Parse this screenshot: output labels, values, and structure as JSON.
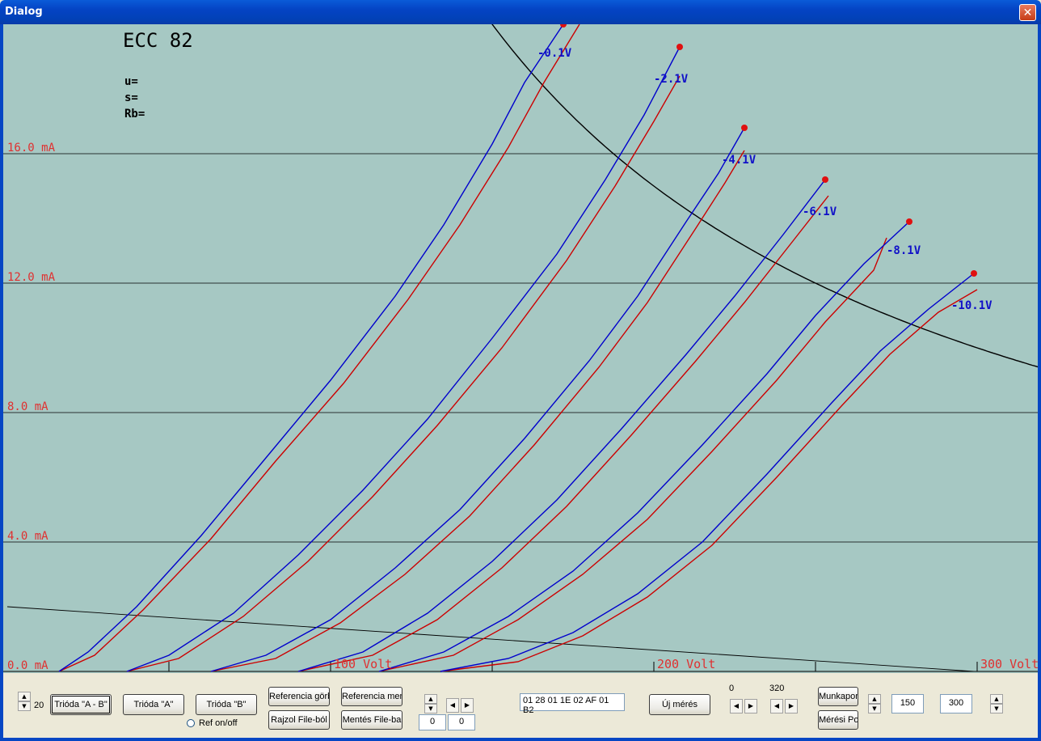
{
  "window": {
    "title": "Dialog",
    "close_label": "✕"
  },
  "chart_data": {
    "type": "line",
    "title": "ECC 82",
    "params": [
      "u=",
      "s=",
      "Rb="
    ],
    "xlim": [
      0,
      320
    ],
    "ylim": [
      0,
      20
    ],
    "x_tick_labels": [
      {
        "x": 100,
        "label": "100 Volt"
      },
      {
        "x": 200,
        "label": "200 Volt"
      },
      {
        "x": 300,
        "label": "300 Volt"
      }
    ],
    "y_tick_labels": [
      {
        "y": 0,
        "label": "0.0 mA"
      },
      {
        "y": 4,
        "label": "4.0 mA"
      },
      {
        "y": 8,
        "label": "8.0 mA"
      },
      {
        "y": 12,
        "label": "12.0 mA"
      },
      {
        "y": 16,
        "label": "16.0 mA"
      }
    ],
    "grid_y": [
      4,
      8,
      12,
      16
    ],
    "minor_x_ticks": [
      50,
      100,
      150,
      200,
      250,
      300
    ],
    "series_colors": {
      "A": "#0000cc",
      "B": "#cc0000"
    },
    "curves": [
      {
        "label": "-0.1V",
        "end": [
          172,
          20.0
        ],
        "A": [
          [
            16,
            0
          ],
          [
            25,
            0.6
          ],
          [
            40,
            2.0
          ],
          [
            60,
            4.2
          ],
          [
            80,
            6.6
          ],
          [
            100,
            9.0
          ],
          [
            120,
            11.6
          ],
          [
            135,
            13.8
          ],
          [
            150,
            16.3
          ],
          [
            160,
            18.2
          ],
          [
            172,
            20.0
          ]
        ],
        "B": [
          [
            16,
            0
          ],
          [
            27,
            0.5
          ],
          [
            42,
            1.9
          ],
          [
            63,
            4.1
          ],
          [
            83,
            6.5
          ],
          [
            104,
            8.9
          ],
          [
            124,
            11.5
          ],
          [
            140,
            13.8
          ],
          [
            155,
            16.2
          ],
          [
            166,
            18.2
          ],
          [
            177,
            20.0
          ]
        ]
      },
      {
        "label": "-2.1V",
        "end": [
          208,
          19.3
        ],
        "A": [
          [
            37,
            0
          ],
          [
            50,
            0.5
          ],
          [
            70,
            1.8
          ],
          [
            90,
            3.6
          ],
          [
            110,
            5.6
          ],
          [
            130,
            7.8
          ],
          [
            150,
            10.3
          ],
          [
            170,
            12.9
          ],
          [
            185,
            15.2
          ],
          [
            197,
            17.2
          ],
          [
            208,
            19.3
          ]
        ],
        "B": [
          [
            37,
            0
          ],
          [
            53,
            0.4
          ],
          [
            73,
            1.7
          ],
          [
            93,
            3.4
          ],
          [
            113,
            5.4
          ],
          [
            133,
            7.6
          ],
          [
            153,
            10.0
          ],
          [
            173,
            12.7
          ],
          [
            188,
            15.0
          ],
          [
            200,
            17.0
          ],
          [
            208,
            18.4
          ]
        ]
      },
      {
        "label": "-4.1V",
        "end": [
          228,
          16.8
        ],
        "A": [
          [
            63,
            0
          ],
          [
            80,
            0.5
          ],
          [
            100,
            1.6
          ],
          [
            120,
            3.2
          ],
          [
            140,
            5.0
          ],
          [
            160,
            7.2
          ],
          [
            180,
            9.6
          ],
          [
            195,
            11.6
          ],
          [
            210,
            13.9
          ],
          [
            220,
            15.4
          ],
          [
            228,
            16.8
          ]
        ],
        "B": [
          [
            63,
            0
          ],
          [
            83,
            0.4
          ],
          [
            103,
            1.5
          ],
          [
            123,
            3.0
          ],
          [
            143,
            4.8
          ],
          [
            163,
            7.0
          ],
          [
            183,
            9.4
          ],
          [
            198,
            11.4
          ],
          [
            213,
            13.7
          ],
          [
            222,
            15.1
          ],
          [
            228,
            16.1
          ]
        ]
      },
      {
        "label": "-6.1V",
        "end": [
          253,
          15.2
        ],
        "A": [
          [
            90,
            0
          ],
          [
            110,
            0.6
          ],
          [
            130,
            1.8
          ],
          [
            150,
            3.4
          ],
          [
            170,
            5.3
          ],
          [
            190,
            7.5
          ],
          [
            210,
            9.8
          ],
          [
            225,
            11.6
          ],
          [
            240,
            13.5
          ],
          [
            253,
            15.2
          ]
        ],
        "B": [
          [
            90,
            0
          ],
          [
            113,
            0.5
          ],
          [
            133,
            1.6
          ],
          [
            153,
            3.2
          ],
          [
            173,
            5.1
          ],
          [
            193,
            7.3
          ],
          [
            213,
            9.6
          ],
          [
            228,
            11.4
          ],
          [
            243,
            13.3
          ],
          [
            254,
            14.7
          ]
        ]
      },
      {
        "label": "-8.1V",
        "end": [
          279,
          13.9
        ],
        "A": [
          [
            115,
            0
          ],
          [
            135,
            0.6
          ],
          [
            155,
            1.7
          ],
          [
            175,
            3.1
          ],
          [
            195,
            4.9
          ],
          [
            215,
            7.0
          ],
          [
            235,
            9.2
          ],
          [
            250,
            11.0
          ],
          [
            265,
            12.6
          ],
          [
            279,
            13.9
          ]
        ],
        "B": [
          [
            115,
            0
          ],
          [
            138,
            0.5
          ],
          [
            158,
            1.6
          ],
          [
            178,
            3.0
          ],
          [
            198,
            4.7
          ],
          [
            218,
            6.8
          ],
          [
            238,
            9.0
          ],
          [
            253,
            10.8
          ],
          [
            268,
            12.4
          ],
          [
            272,
            13.4
          ]
        ]
      },
      {
        "label": "-10.1V",
        "end": [
          299,
          12.3
        ],
        "A": [
          [
            134,
            0
          ],
          [
            155,
            0.4
          ],
          [
            175,
            1.2
          ],
          [
            195,
            2.4
          ],
          [
            215,
            4.0
          ],
          [
            235,
            6.1
          ],
          [
            255,
            8.3
          ],
          [
            270,
            9.9
          ],
          [
            285,
            11.2
          ],
          [
            299,
            12.3
          ]
        ],
        "B": [
          [
            134,
            0
          ],
          [
            158,
            0.3
          ],
          [
            178,
            1.1
          ],
          [
            198,
            2.3
          ],
          [
            218,
            3.9
          ],
          [
            238,
            6.0
          ],
          [
            258,
            8.2
          ],
          [
            273,
            9.8
          ],
          [
            288,
            11.1
          ],
          [
            300,
            11.8
          ]
        ]
      }
    ],
    "curve_label_pos": [
      [
        164,
        19.0
      ],
      [
        200,
        18.2
      ],
      [
        221,
        15.7
      ],
      [
        246,
        14.1
      ],
      [
        272,
        12.9
      ],
      [
        292,
        11.2
      ]
    ],
    "power_hyperbola_watts": 3.0,
    "load_line": [
      [
        0,
        2.0
      ],
      [
        299,
        0
      ]
    ]
  },
  "controls": {
    "spin_value": "20",
    "btn_trioda_ab": "Trióda \"A - B\"",
    "btn_trioda_a": "Trióda  \"A\"",
    "btn_trioda_b": "Trióda  \"B\"",
    "radio_ref": "Ref on/off",
    "btn_ref_gorbe": "Referencia görbe",
    "btn_ref_mentes": "Referencia mentés",
    "btn_rajzol": "Rajzol File-ból",
    "btn_mentes_file": "Mentés File-ba",
    "edit_left": "0",
    "edit_right": "0",
    "hex_data": "01 28 01 1E 02 AF 01 B2",
    "btn_uj_meres": "Új mérés",
    "label_0": "0",
    "label_320": "320",
    "btn_munkapont": "Munkapont",
    "btn_meresi_pont": "Mérési Pont",
    "edit_150": "150",
    "edit_300": "300"
  }
}
